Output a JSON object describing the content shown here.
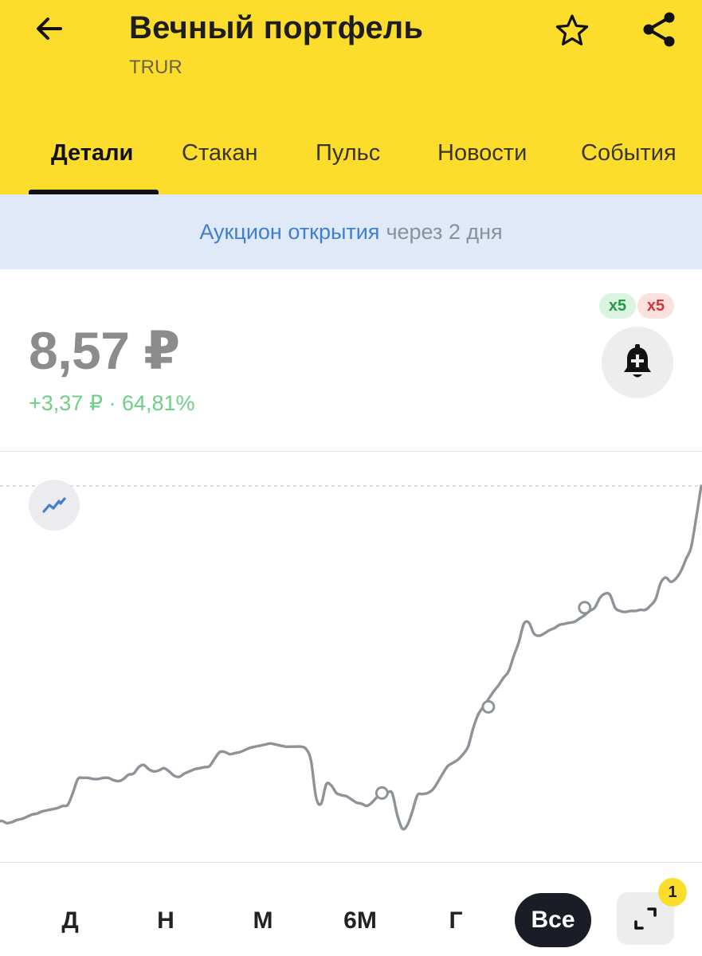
{
  "header": {
    "title": "Вечный портфель",
    "ticker": "TRUR",
    "back_icon": "arrow-left-icon",
    "favorite_icon": "star-outline-icon",
    "share_icon": "share-icon",
    "background": "#fddd2b"
  },
  "tabs": [
    {
      "label": "Детали",
      "active": true
    },
    {
      "label": "Стакан",
      "active": false
    },
    {
      "label": "Пульс",
      "active": false
    },
    {
      "label": "Новости",
      "active": false
    },
    {
      "label": "События",
      "active": false
    }
  ],
  "banner": {
    "link_text": "Аукцион открытия",
    "rest_text": "через 2 дня"
  },
  "quote": {
    "price": "8,57 ₽",
    "change": "+3,37 ₽ · 64,81%",
    "change_color": "#6fcf87",
    "leverage_long": "x5",
    "leverage_short": "x5",
    "alert_icon": "bell-plus-icon"
  },
  "chart_data": {
    "type": "line",
    "title": "",
    "xlabel": "",
    "ylabel": "",
    "grid": false,
    "y": [
      5.45,
      5.46,
      5.44,
      5.45,
      5.47,
      5.48,
      5.5,
      5.52,
      5.53,
      5.55,
      5.56,
      5.57,
      5.58,
      5.6,
      5.61,
      5.72,
      5.85,
      5.86,
      5.86,
      5.85,
      5.85,
      5.86,
      5.86,
      5.84,
      5.83,
      5.85,
      5.89,
      5.9,
      5.96,
      5.98,
      5.94,
      5.92,
      5.93,
      5.95,
      5.92,
      5.88,
      5.87,
      5.9,
      5.92,
      5.94,
      5.95,
      5.96,
      5.97,
      6.04,
      6.1,
      6.1,
      6.08,
      6.09,
      6.1,
      6.12,
      6.14,
      6.15,
      6.16,
      6.17,
      6.18,
      6.17,
      6.16,
      6.15,
      6.15,
      6.15,
      6.15,
      6.13,
      6.02,
      5.68,
      5.62,
      5.8,
      5.79,
      5.72,
      5.7,
      5.69,
      5.66,
      5.63,
      5.62,
      5.6,
      5.63,
      5.68,
      5.71,
      5.72,
      5.72,
      5.52,
      5.39,
      5.42,
      5.55,
      5.7,
      5.71,
      5.72,
      5.75,
      5.82,
      5.9,
      5.97,
      6.0,
      6.03,
      6.08,
      6.15,
      6.32,
      6.45,
      6.52,
      6.59,
      6.66,
      6.72,
      6.79,
      6.85,
      6.99,
      7.12,
      7.29,
      7.3,
      7.2,
      7.18,
      7.2,
      7.23,
      7.25,
      7.28,
      7.29,
      7.3,
      7.31,
      7.34,
      7.37,
      7.41,
      7.44,
      7.53,
      7.57,
      7.56,
      7.44,
      7.41,
      7.4,
      7.41,
      7.41,
      7.42,
      7.42,
      7.46,
      7.52,
      7.67,
      7.72,
      7.68,
      7.71,
      7.78,
      7.89,
      8.0,
      8.27,
      8.57
    ],
    "highlighted_points": [
      {
        "index": 76,
        "y": 5.72
      },
      {
        "index": 97,
        "y": 6.52
      },
      {
        "index": 116,
        "y": 7.44
      }
    ],
    "reference_line": 8.57,
    "line_color": "#8e9399"
  },
  "periods": [
    {
      "label": "Д",
      "active": false
    },
    {
      "label": "Н",
      "active": false
    },
    {
      "label": "М",
      "active": false
    },
    {
      "label": "6М",
      "active": false
    },
    {
      "label": "Г",
      "active": false
    },
    {
      "label": "Все",
      "active": true
    }
  ],
  "expand": {
    "icon": "expand-corners-icon",
    "badge": "1"
  }
}
